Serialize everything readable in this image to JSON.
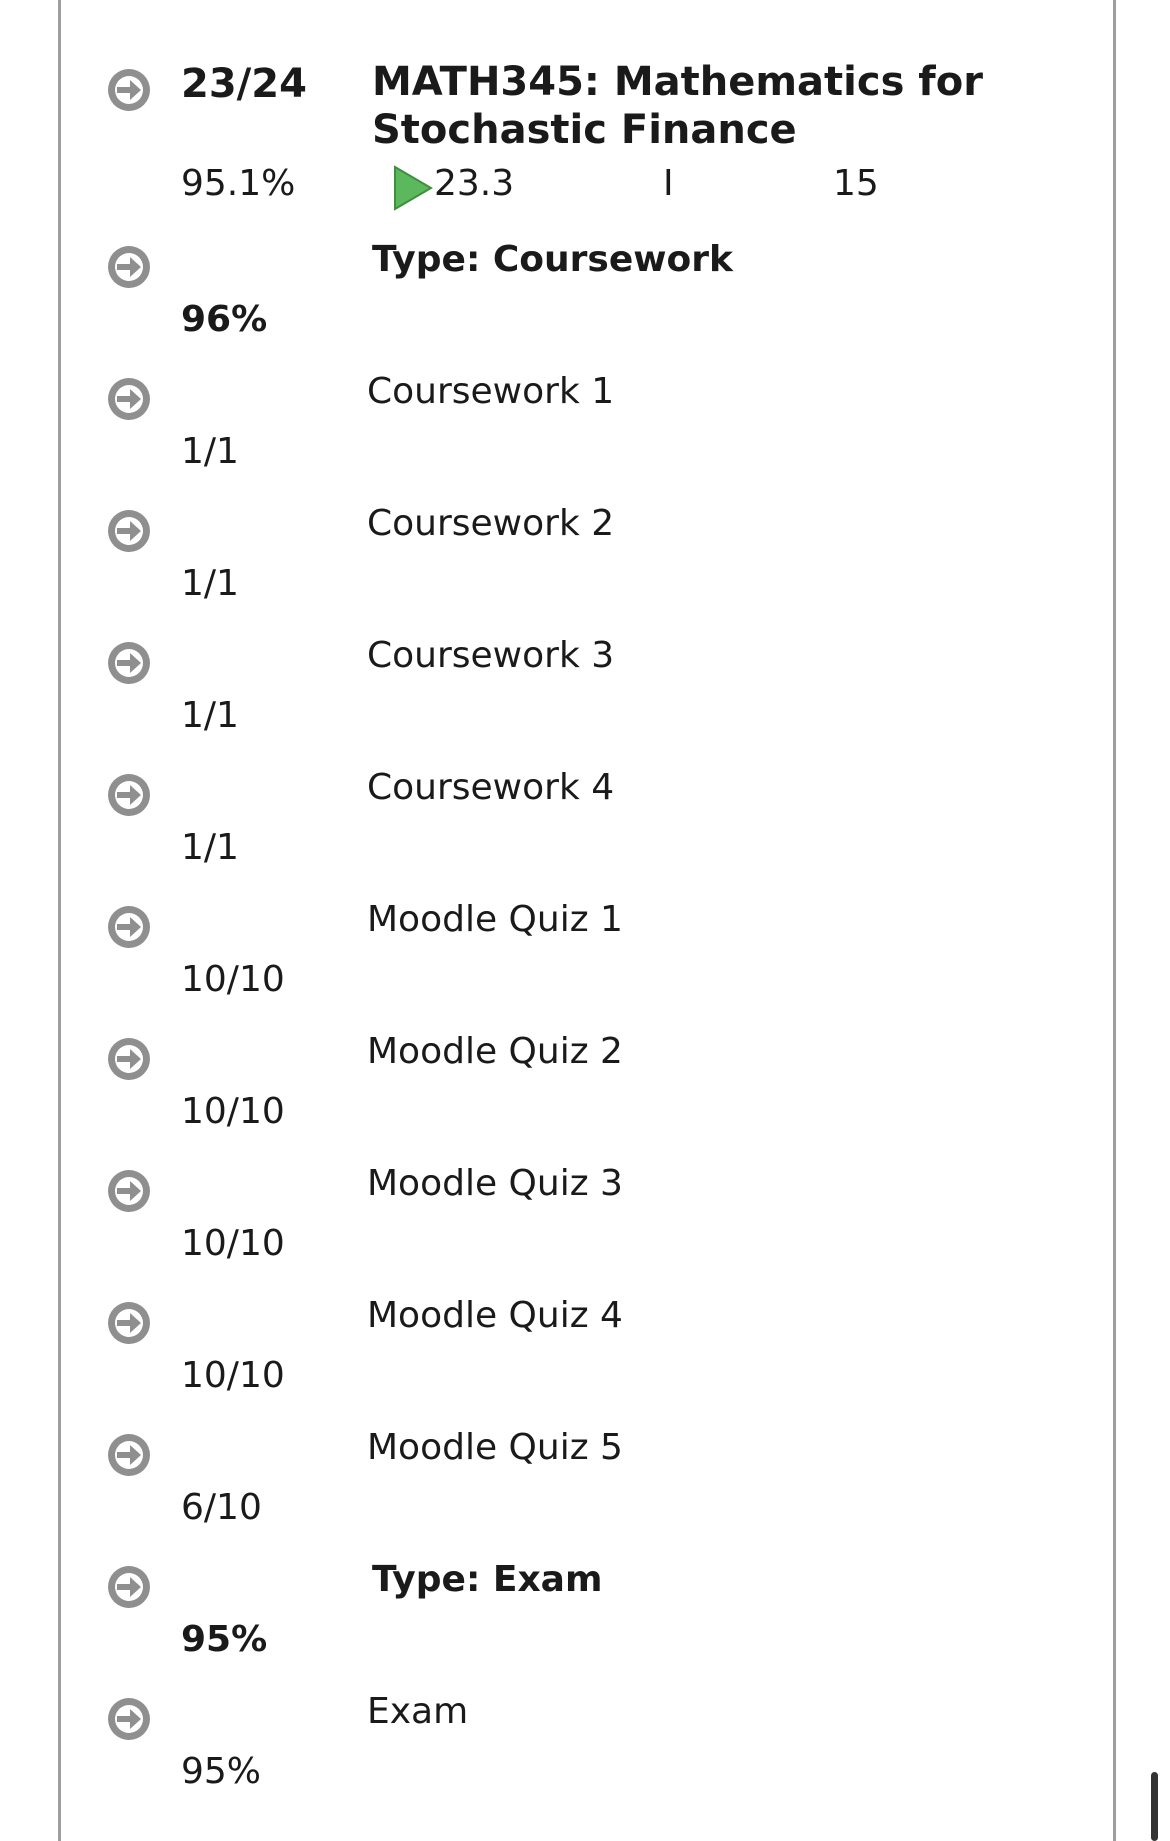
{
  "course": {
    "score": "23/24",
    "title": "MATH345: Mathematics for Stochastic Finance",
    "percent": "95.1%",
    "trend_value": "23.3",
    "grade_letter": "I",
    "rank": "15"
  },
  "sections": [
    {
      "heading": "Type: Coursework",
      "percent": "96%",
      "items": [
        {
          "name": "Coursework 1",
          "score": "1/1"
        },
        {
          "name": "Coursework 2",
          "score": "1/1"
        },
        {
          "name": "Coursework 3",
          "score": "1/1"
        },
        {
          "name": "Coursework 4",
          "score": "1/1"
        },
        {
          "name": "Moodle Quiz 1",
          "score": "10/10"
        },
        {
          "name": "Moodle Quiz 2",
          "score": "10/10"
        },
        {
          "name": "Moodle Quiz 3",
          "score": "10/10"
        },
        {
          "name": "Moodle Quiz 4",
          "score": "10/10"
        },
        {
          "name": "Moodle Quiz 5",
          "score": "6/10"
        }
      ]
    },
    {
      "heading": "Type: Exam",
      "percent": "95%",
      "items": [
        {
          "name": "Exam",
          "score": "95%"
        }
      ]
    }
  ],
  "colors": {
    "arrow_circle": "#8f8f8f",
    "play_green": "#5cb85c",
    "border": "#9e9e9e"
  }
}
